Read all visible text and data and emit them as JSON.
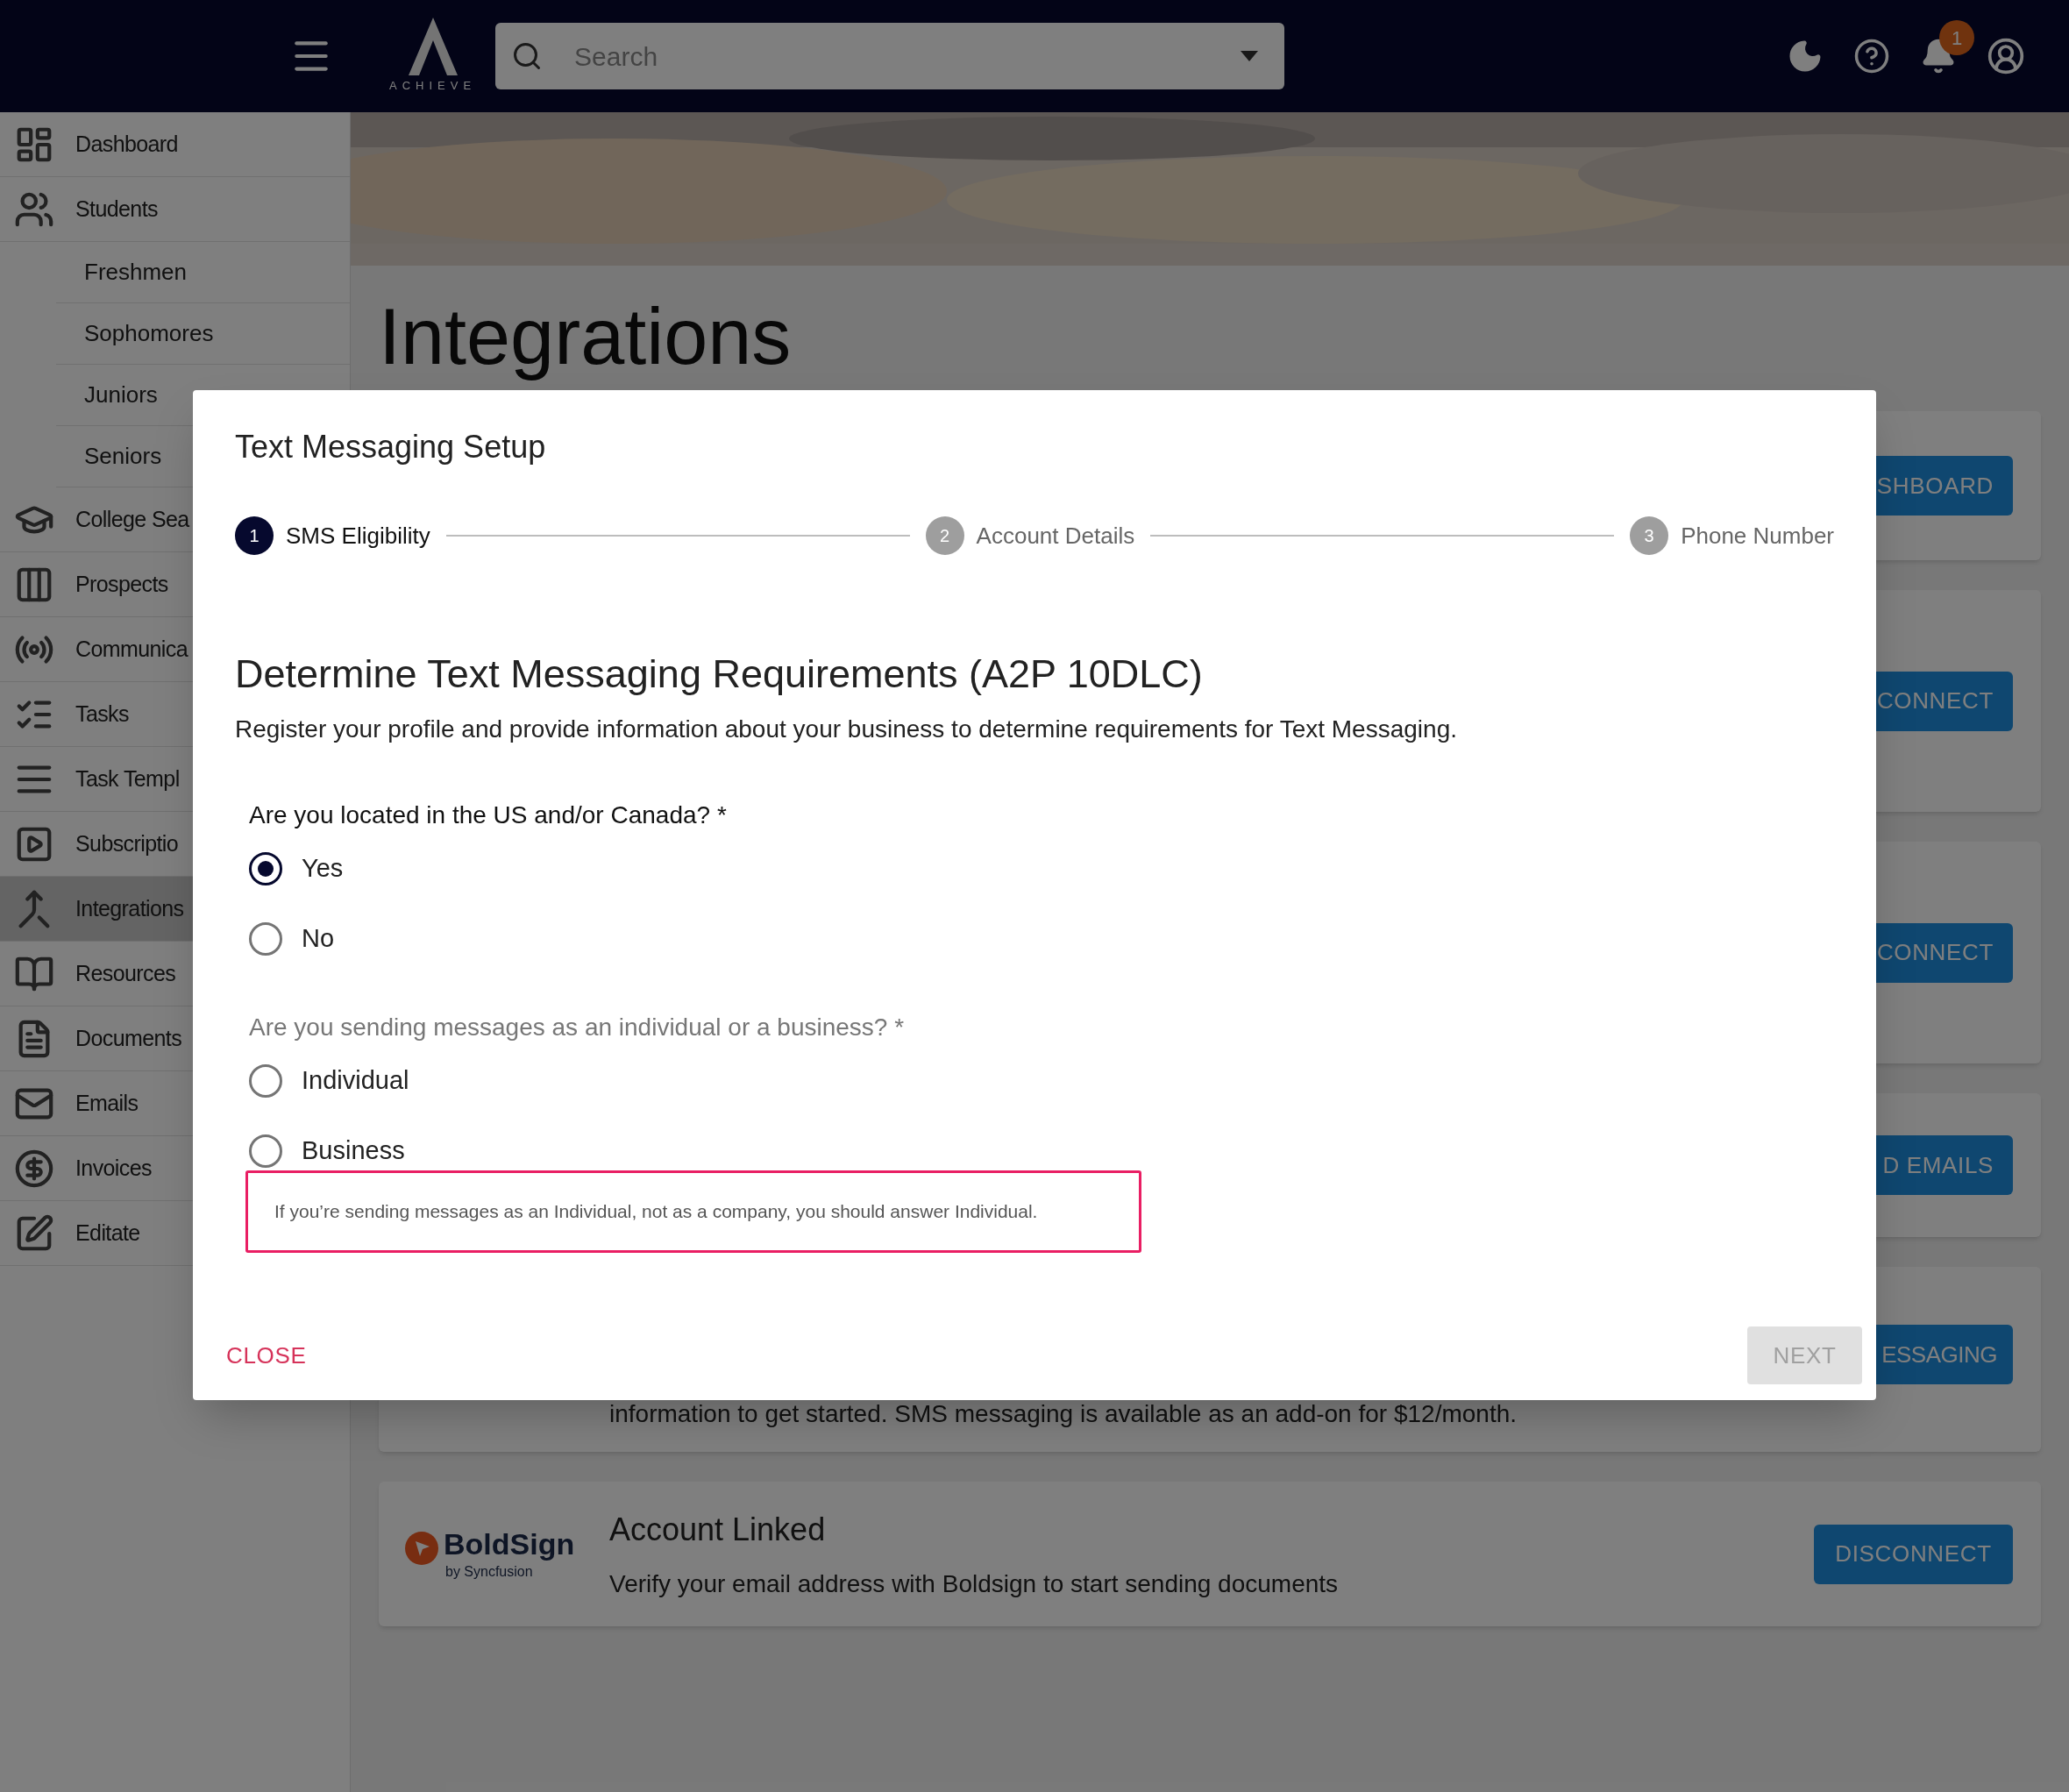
{
  "header": {
    "logo_text": "ACHIEVE",
    "search": {
      "placeholder": "Search"
    },
    "notifications_badge": "1"
  },
  "sidebar": {
    "items": [
      {
        "label": "Dashboard",
        "selected": false
      },
      {
        "label": "Students",
        "selected": false,
        "children": [
          {
            "label": "Freshmen",
            "selected": false
          },
          {
            "label": "Sophomores",
            "selected": false
          },
          {
            "label": "Juniors",
            "selected": false
          },
          {
            "label": "Seniors",
            "selected": false
          }
        ]
      },
      {
        "label": "College Sea",
        "selected": false
      },
      {
        "label": "Prospects",
        "selected": false
      },
      {
        "label": "Communica",
        "selected": false
      },
      {
        "label": "Tasks",
        "selected": false
      },
      {
        "label": "Task Templ",
        "selected": false
      },
      {
        "label": "Subscriptio",
        "selected": false
      },
      {
        "label": "Integrations",
        "selected": true
      },
      {
        "label": "Resources",
        "selected": false
      },
      {
        "label": "Documents",
        "selected": false
      },
      {
        "label": "Emails",
        "selected": false
      },
      {
        "label": "Invoices",
        "selected": false
      },
      {
        "label": "Editate",
        "selected": false
      }
    ]
  },
  "page": {
    "title": "Integrations",
    "cards": [
      {
        "kind": "button_only",
        "button": "SHBOARD"
      },
      {
        "kind": "button_only",
        "button": "CONNECT"
      },
      {
        "kind": "button_only",
        "button": "CONNECT"
      },
      {
        "kind": "button_only",
        "button": "D EMAILS"
      },
      {
        "kind": "text_button",
        "text": "information to get started. SMS messaging is available as an add-on for $12/month.",
        "button": "ESSAGING"
      },
      {
        "kind": "linked",
        "logo_name": "BoldSign",
        "logo_sub": "by Syncfusion",
        "title": "Account Linked",
        "description": "Verify your email address with Boldsign to start sending documents",
        "button": "DISCONNECT"
      }
    ]
  },
  "modal": {
    "title": "Text Messaging Setup",
    "steps": [
      {
        "number": "1",
        "label": "SMS Eligibility",
        "selected": true
      },
      {
        "number": "2",
        "label": "Account Details",
        "selected": false
      },
      {
        "number": "3",
        "label": "Phone Number",
        "selected": false
      }
    ],
    "heading": "Determine Text Messaging Requirements (A2P 10DLC)",
    "description": "Register your profile and provide information about your business to determine requirements for Text Messaging.",
    "questions": [
      {
        "label": "Are you located in the US and/or Canada? *",
        "focused": true,
        "options": [
          {
            "label": "Yes",
            "selected": true
          },
          {
            "label": "No",
            "selected": false
          }
        ]
      },
      {
        "label": "Are you sending messages as an individual or a business? *",
        "focused": false,
        "options": [
          {
            "label": "Individual",
            "selected": false
          },
          {
            "label": "Business",
            "selected": false
          }
        ]
      }
    ],
    "note": "If you’re sending messages as an Individual, not as a company, you should answer Individual.",
    "close": "CLOSE",
    "next": {
      "label": "NEXT",
      "disabled": true
    }
  }
}
